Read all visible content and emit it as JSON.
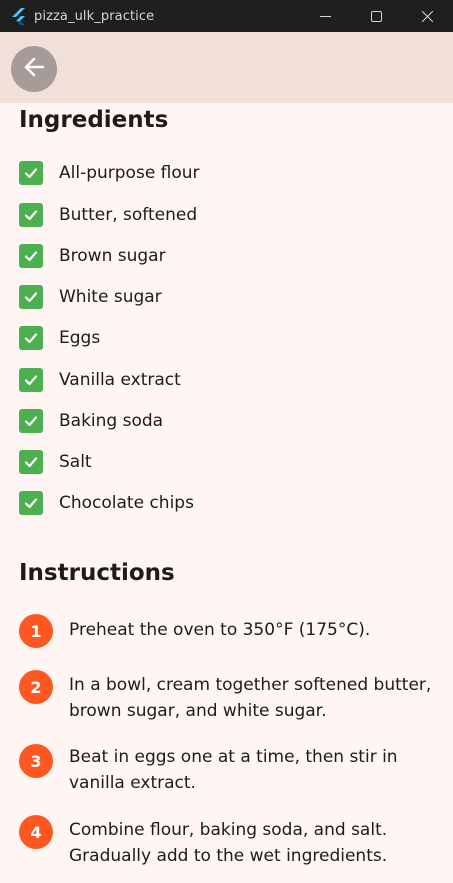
{
  "window": {
    "title": "pizza_ulk_practice",
    "app_icon": "flutter-logo-icon",
    "controls": [
      "minimize-icon",
      "maximize-icon",
      "close-icon"
    ]
  },
  "appbar": {
    "back_icon": "arrow-back-icon",
    "background": "#f1dfd9"
  },
  "ingredients": {
    "title": "Ingredients",
    "items": [
      {
        "label": "All-purpose flour",
        "checked": true
      },
      {
        "label": "Butter, softened",
        "checked": true
      },
      {
        "label": "Brown sugar",
        "checked": true
      },
      {
        "label": "White sugar",
        "checked": true
      },
      {
        "label": "Eggs",
        "checked": true
      },
      {
        "label": "Vanilla extract",
        "checked": true
      },
      {
        "label": "Baking soda",
        "checked": true
      },
      {
        "label": "Salt",
        "checked": true
      },
      {
        "label": "Chocolate chips",
        "checked": true
      }
    ]
  },
  "instructions": {
    "title": "Instructions",
    "steps": [
      {
        "number": "1",
        "text": "Preheat the oven to 350°F (175°C)."
      },
      {
        "number": "2",
        "text": "In a bowl, cream together softened butter, brown sugar, and white sugar."
      },
      {
        "number": "3",
        "text": "Beat in eggs one at a time, then stir in vanilla extract."
      },
      {
        "number": "4",
        "text": "Combine flour, baking soda, and salt. Gradually add to the wet ingredients."
      }
    ]
  },
  "colors": {
    "checkbox": "#4caf50",
    "step_badge": "#ff5722",
    "page_background": "#fff5f3"
  }
}
